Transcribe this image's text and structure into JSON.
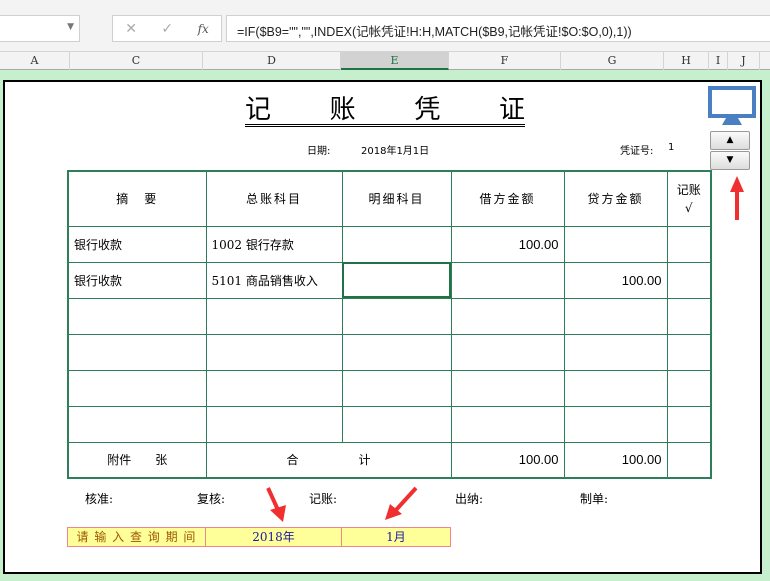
{
  "formula_bar": {
    "formula": "=IF($B9=\"\",\"\",INDEX(记帐凭证!H:H,MATCH($B9,记帐凭证!$O:$O,0),1))",
    "cancel": "✕",
    "enter": "✓",
    "fx": "fx"
  },
  "columns": [
    "A",
    "C",
    "D",
    "E",
    "F",
    "G",
    "H",
    "I",
    "J"
  ],
  "voucher": {
    "title_chars": [
      "记",
      "账",
      "凭",
      "证"
    ],
    "date_label": "日期:",
    "date": "2018年1月1日",
    "number_label": "凭证号:",
    "number": "1",
    "headers": [
      "摘　要",
      "总账科目",
      "明细科目",
      "借方金额",
      "贷方金额",
      "记账"
    ],
    "check": "√",
    "rows": [
      [
        "银行收款",
        "1002 银行存款",
        "",
        "100.00",
        ""
      ],
      [
        "银行收款",
        "5101 商品销售收入",
        "",
        "",
        "100.00"
      ]
    ],
    "footer": {
      "attach": "附件　　张",
      "total": "合　　　　　计",
      "debit_total": "100.00",
      "credit_total": "100.00"
    },
    "signatures": [
      "核准:",
      "复核:",
      "记账:",
      "出纳:",
      "制单:"
    ]
  },
  "query": {
    "label": "请 输 入 查 询 期 间",
    "year": "2018年",
    "month": "1月"
  },
  "accent": "#217346"
}
